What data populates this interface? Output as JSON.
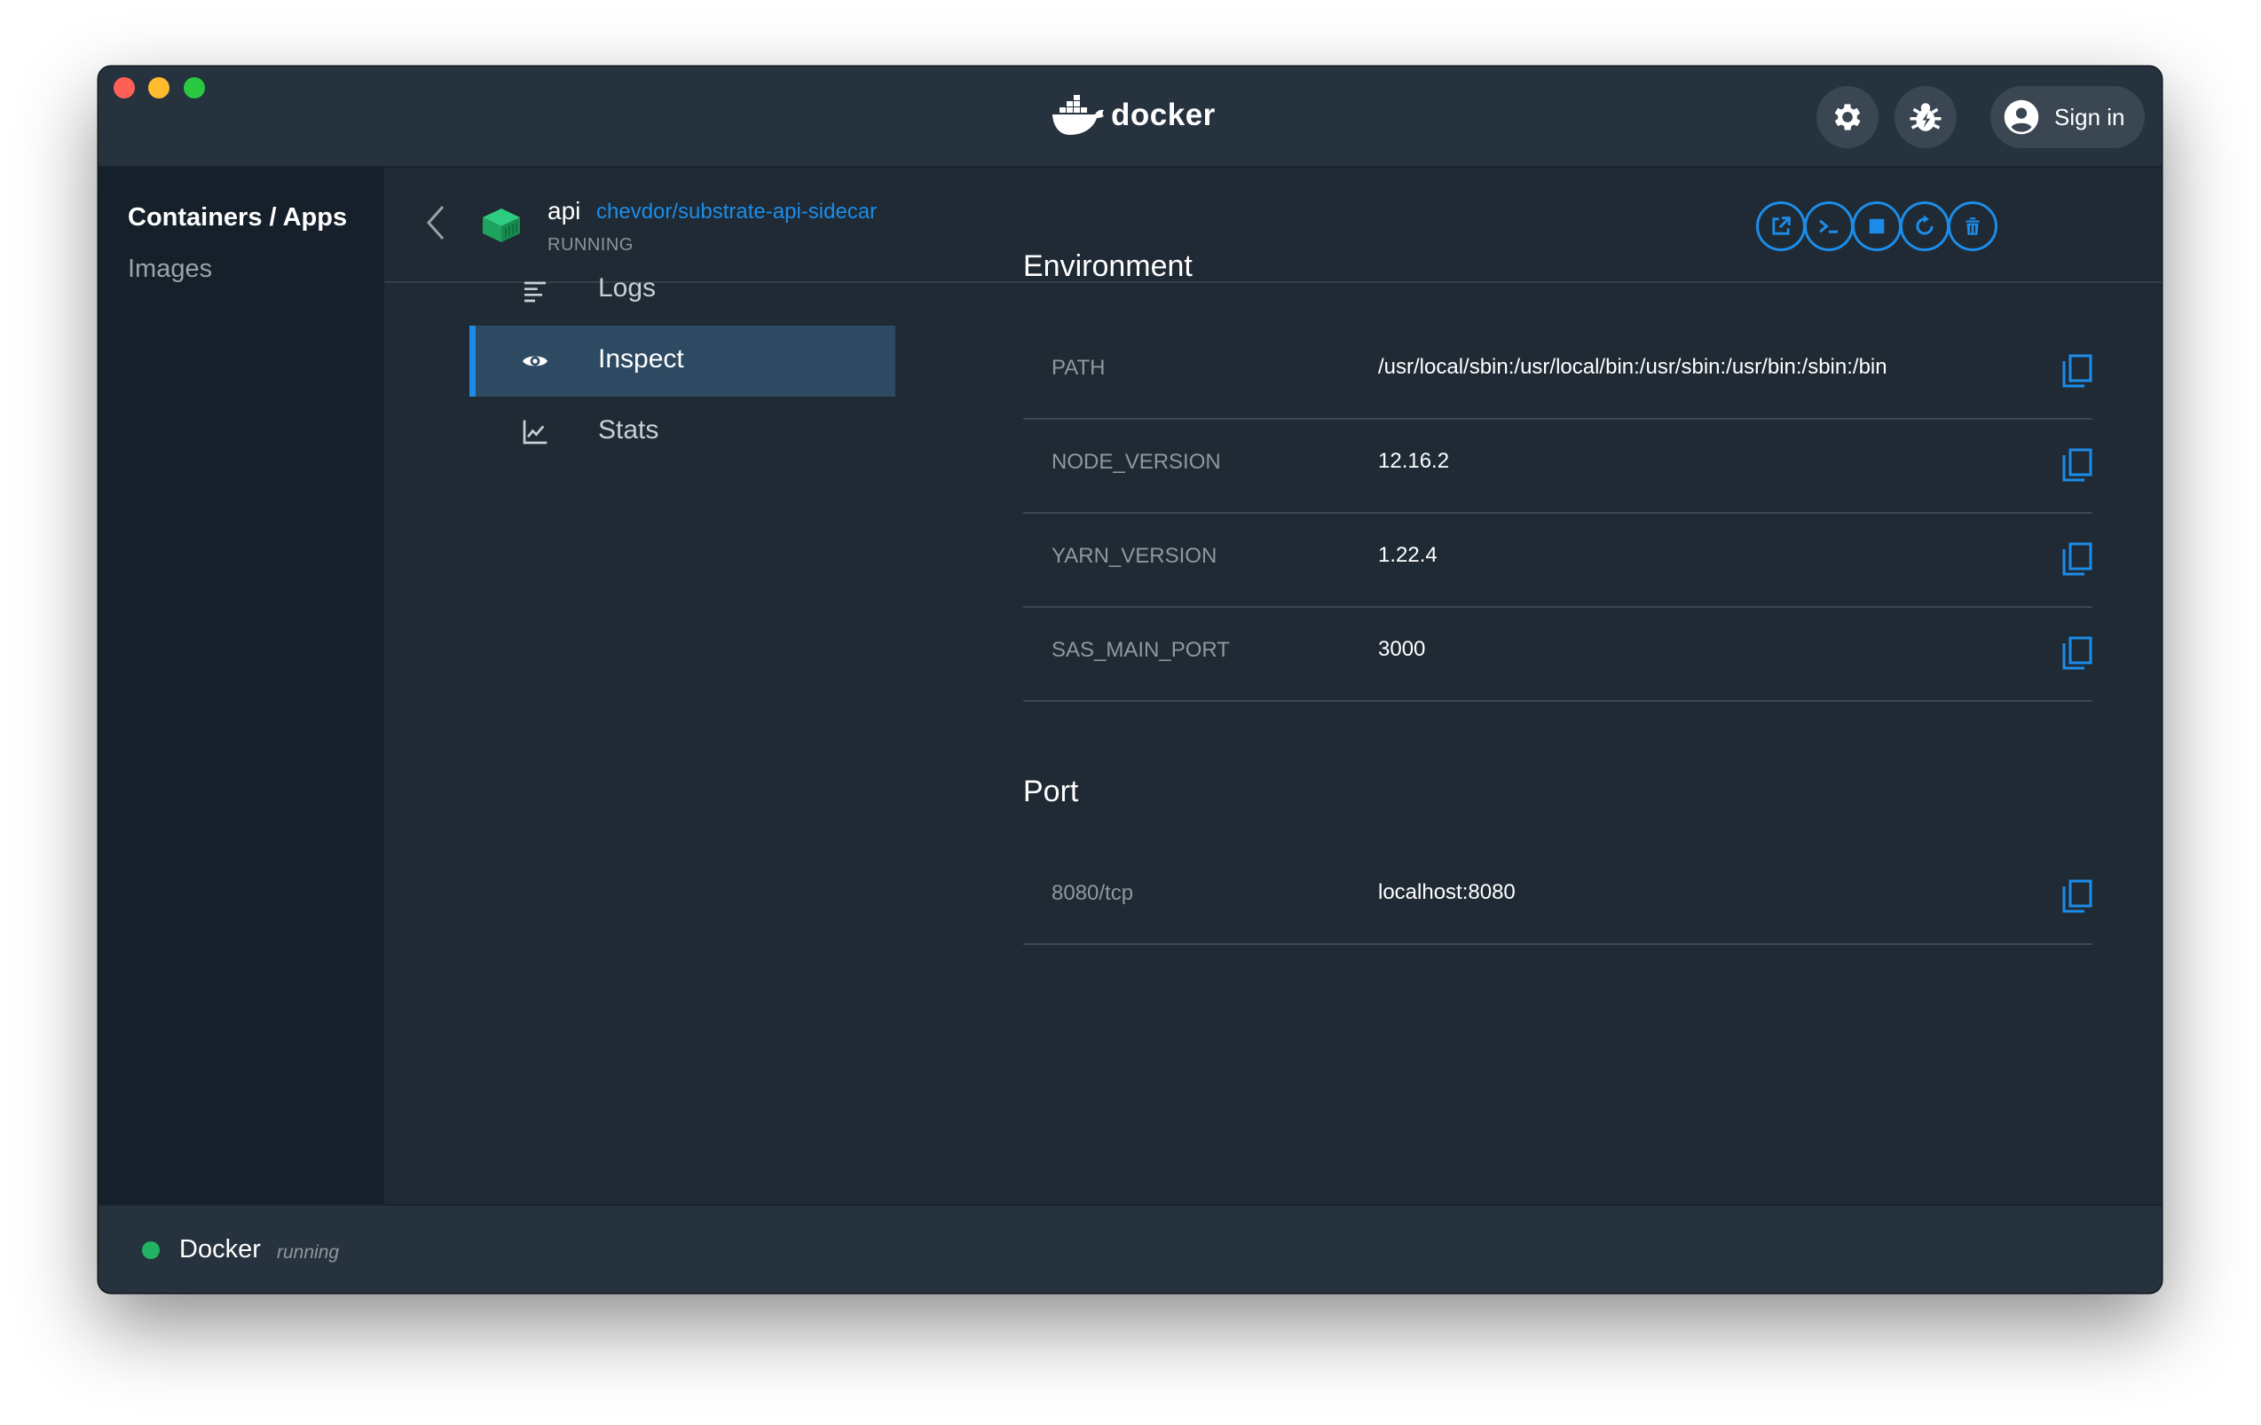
{
  "app": {
    "logo_text": "docker",
    "sign_in_label": "Sign in"
  },
  "sidebar": {
    "items": [
      {
        "label": "Containers / Apps"
      },
      {
        "label": "Images"
      }
    ]
  },
  "container": {
    "name": "api",
    "image": "chevdor/substrate-api-sidecar",
    "status": "RUNNING"
  },
  "actions": [
    {
      "icon": "open-in-browser-icon"
    },
    {
      "icon": "cli-icon"
    },
    {
      "icon": "stop-icon"
    },
    {
      "icon": "restart-icon"
    },
    {
      "icon": "delete-icon"
    }
  ],
  "tabs": [
    {
      "label": "Logs",
      "icon": "logs-icon"
    },
    {
      "label": "Inspect",
      "icon": "eye-icon"
    },
    {
      "label": "Stats",
      "icon": "stats-icon"
    }
  ],
  "environment": {
    "title": "Environment",
    "rows": [
      {
        "key": "PATH",
        "value": "/usr/local/sbin:/usr/local/bin:/usr/sbin:/usr/bin:/sbin:/bin"
      },
      {
        "key": "NODE_VERSION",
        "value": "12.16.2"
      },
      {
        "key": "YARN_VERSION",
        "value": "1.22.4"
      },
      {
        "key": "SAS_MAIN_PORT",
        "value": "3000"
      }
    ]
  },
  "port": {
    "title": "Port",
    "rows": [
      {
        "key": "8080/tcp",
        "value": "localhost:8080"
      }
    ]
  },
  "statusbar": {
    "title": "Docker",
    "state": "running"
  },
  "colors": {
    "accent": "#1d8ce8",
    "running": "#21b363",
    "window_bg": "#1f2a34",
    "sidebar_bg": "#15202a"
  }
}
